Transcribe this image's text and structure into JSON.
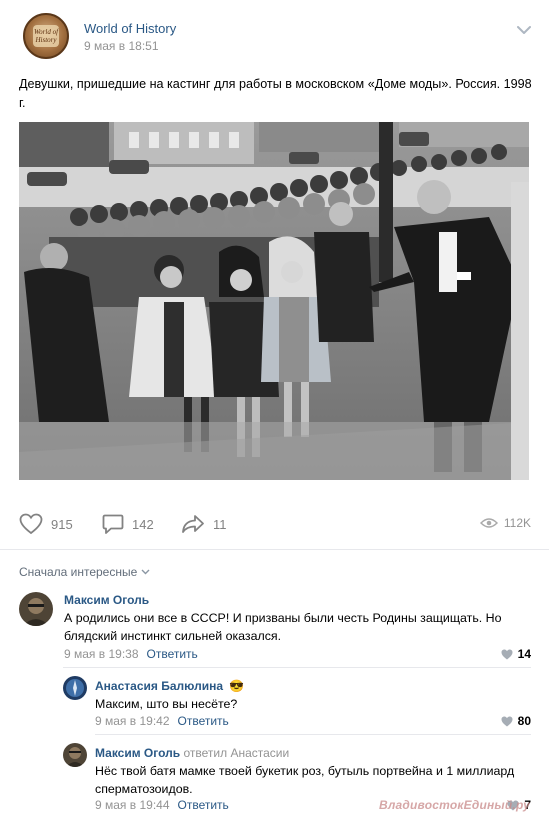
{
  "post": {
    "group_name": "World of History",
    "logo_text": "World of History",
    "time": "9 мая в 18:51",
    "text": "Девушки, пришедшие на кастинг для работы в московском «Доме моды». Россия. 1998 г.",
    "photo_alt": "crowd",
    "likes": "915",
    "comments": "142",
    "shares": "11",
    "views": "112K"
  },
  "comments_section": {
    "sort_label": "Сначала интересные"
  },
  "comments": [
    {
      "author": "Максим Оголь",
      "text": "А родились они все в СССР! И призваны были честь Родины защищать. Но блядский инстинкт сильней оказался.",
      "time": "9 мая в 19:38",
      "reply_label": "Ответить",
      "likes": "14"
    },
    {
      "author": "Анастасия Балюлина",
      "emoji": "😎",
      "text": "Максим, што вы несёте?",
      "time": "9 мая в 19:42",
      "reply_label": "Ответить",
      "likes": "80"
    },
    {
      "author": "Максим Оголь",
      "reply_to": "ответил Анастасии",
      "text": "Нёс твой батя мамке твоей букетик роз, бутыль портвейна и 1 миллиард сперматозоидов.",
      "time": "9 мая в 19:44",
      "reply_label": "Ответить",
      "likes": "7"
    }
  ],
  "watermark": "ВладивостокЕдиный.ру",
  "colors": {
    "link": "#2a5885",
    "muted": "#939393",
    "icon": "#828282",
    "divider": "#e7e8ec"
  }
}
